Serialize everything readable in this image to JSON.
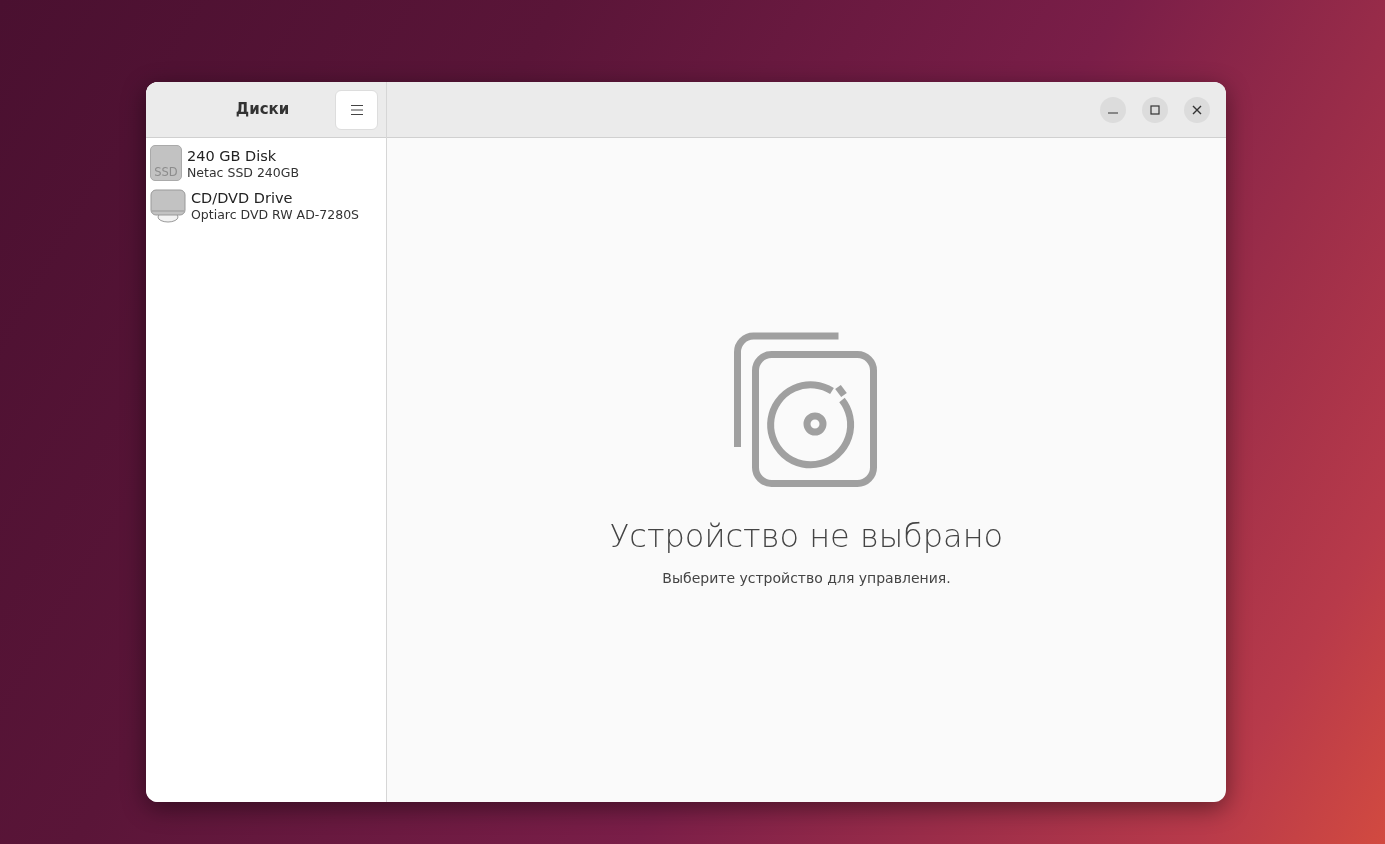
{
  "sidebar": {
    "title": "Диски",
    "devices": [
      {
        "kind": "ssd",
        "icon_label": "SSD",
        "name": "240 GB Disk",
        "model": "Netac SSD 240GB",
        "selected": false
      },
      {
        "kind": "optical",
        "name": "CD/DVD Drive",
        "model": "Optiarc DVD RW AD-7280S",
        "selected": false
      }
    ]
  },
  "empty_state": {
    "title": "Устройство не выбрано",
    "description": "Выберите устройство для управления."
  }
}
